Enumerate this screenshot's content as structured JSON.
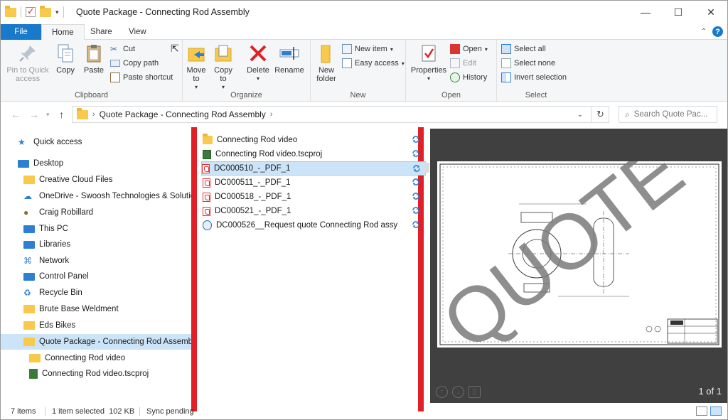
{
  "window": {
    "title": "Quote Package - Connecting Rod Assembly"
  },
  "tabs": {
    "file": "File",
    "home": "Home",
    "share": "Share",
    "view": "View"
  },
  "ribbon": {
    "clipboard": {
      "label": "Clipboard",
      "pin": "Pin to Quick access",
      "copy": "Copy",
      "paste": "Paste",
      "cut": "Cut",
      "copy_path": "Copy path",
      "paste_shortcut": "Paste shortcut"
    },
    "organize": {
      "label": "Organize",
      "move_to": "Move to",
      "copy_to": "Copy to",
      "delete": "Delete",
      "rename": "Rename"
    },
    "new": {
      "label": "New",
      "new_folder": "New folder",
      "new_item": "New item",
      "easy_access": "Easy access"
    },
    "open": {
      "label": "Open",
      "properties": "Properties",
      "open": "Open",
      "edit": "Edit",
      "history": "History"
    },
    "select": {
      "label": "Select",
      "select_all": "Select all",
      "select_none": "Select none",
      "invert": "Invert selection"
    }
  },
  "address": {
    "path": "Quote Package - Connecting Rod Assembly",
    "search_placeholder": "Search Quote Pac..."
  },
  "nav": [
    {
      "label": "Quick access",
      "icon": "star-icon"
    },
    {
      "label": "Desktop",
      "icon": "desktop-icon"
    },
    {
      "label": "Creative Cloud Files",
      "icon": "folder-icon"
    },
    {
      "label": "OneDrive - Swoosh Technologies & Solutions",
      "icon": "cloud-icon"
    },
    {
      "label": "Craig Robillard",
      "icon": "user-icon"
    },
    {
      "label": "This PC",
      "icon": "pc-icon"
    },
    {
      "label": "Libraries",
      "icon": "library-icon"
    },
    {
      "label": "Network",
      "icon": "network-icon"
    },
    {
      "label": "Control Panel",
      "icon": "control-panel-icon"
    },
    {
      "label": "Recycle Bin",
      "icon": "recycle-bin-icon"
    },
    {
      "label": "Brute Base Weldment",
      "icon": "folder-icon"
    },
    {
      "label": "Eds Bikes",
      "icon": "folder-icon"
    },
    {
      "label": "Quote Package - Connecting Rod Assembly",
      "icon": "folder-icon"
    },
    {
      "label": "Connecting Rod video",
      "icon": "folder-icon"
    },
    {
      "label": "Connecting Rod video.tscproj",
      "icon": "project-file-icon"
    }
  ],
  "files": [
    {
      "name": "Connecting Rod video",
      "type": "folder"
    },
    {
      "name": "Connecting Rod video.tscproj",
      "type": "proj"
    },
    {
      "name": "DC000510_-_PDF_1",
      "type": "pdf"
    },
    {
      "name": "DC000511_-_PDF_1",
      "type": "pdf"
    },
    {
      "name": "DC000518_-_PDF_1",
      "type": "pdf"
    },
    {
      "name": "DC000521_-_PDF_1",
      "type": "pdf"
    },
    {
      "name": "DC000526__Request quote Connecting Rod assy",
      "type": "doc"
    }
  ],
  "preview": {
    "watermark": "QUOTE",
    "page": "1 of 1"
  },
  "status": {
    "items": "7 items",
    "selected": "1 item selected  102 KB",
    "sync": "Sync pending"
  },
  "colors": {
    "accent": "#1979ca",
    "selection": "#cce4f7",
    "marker": "#e01f26"
  }
}
